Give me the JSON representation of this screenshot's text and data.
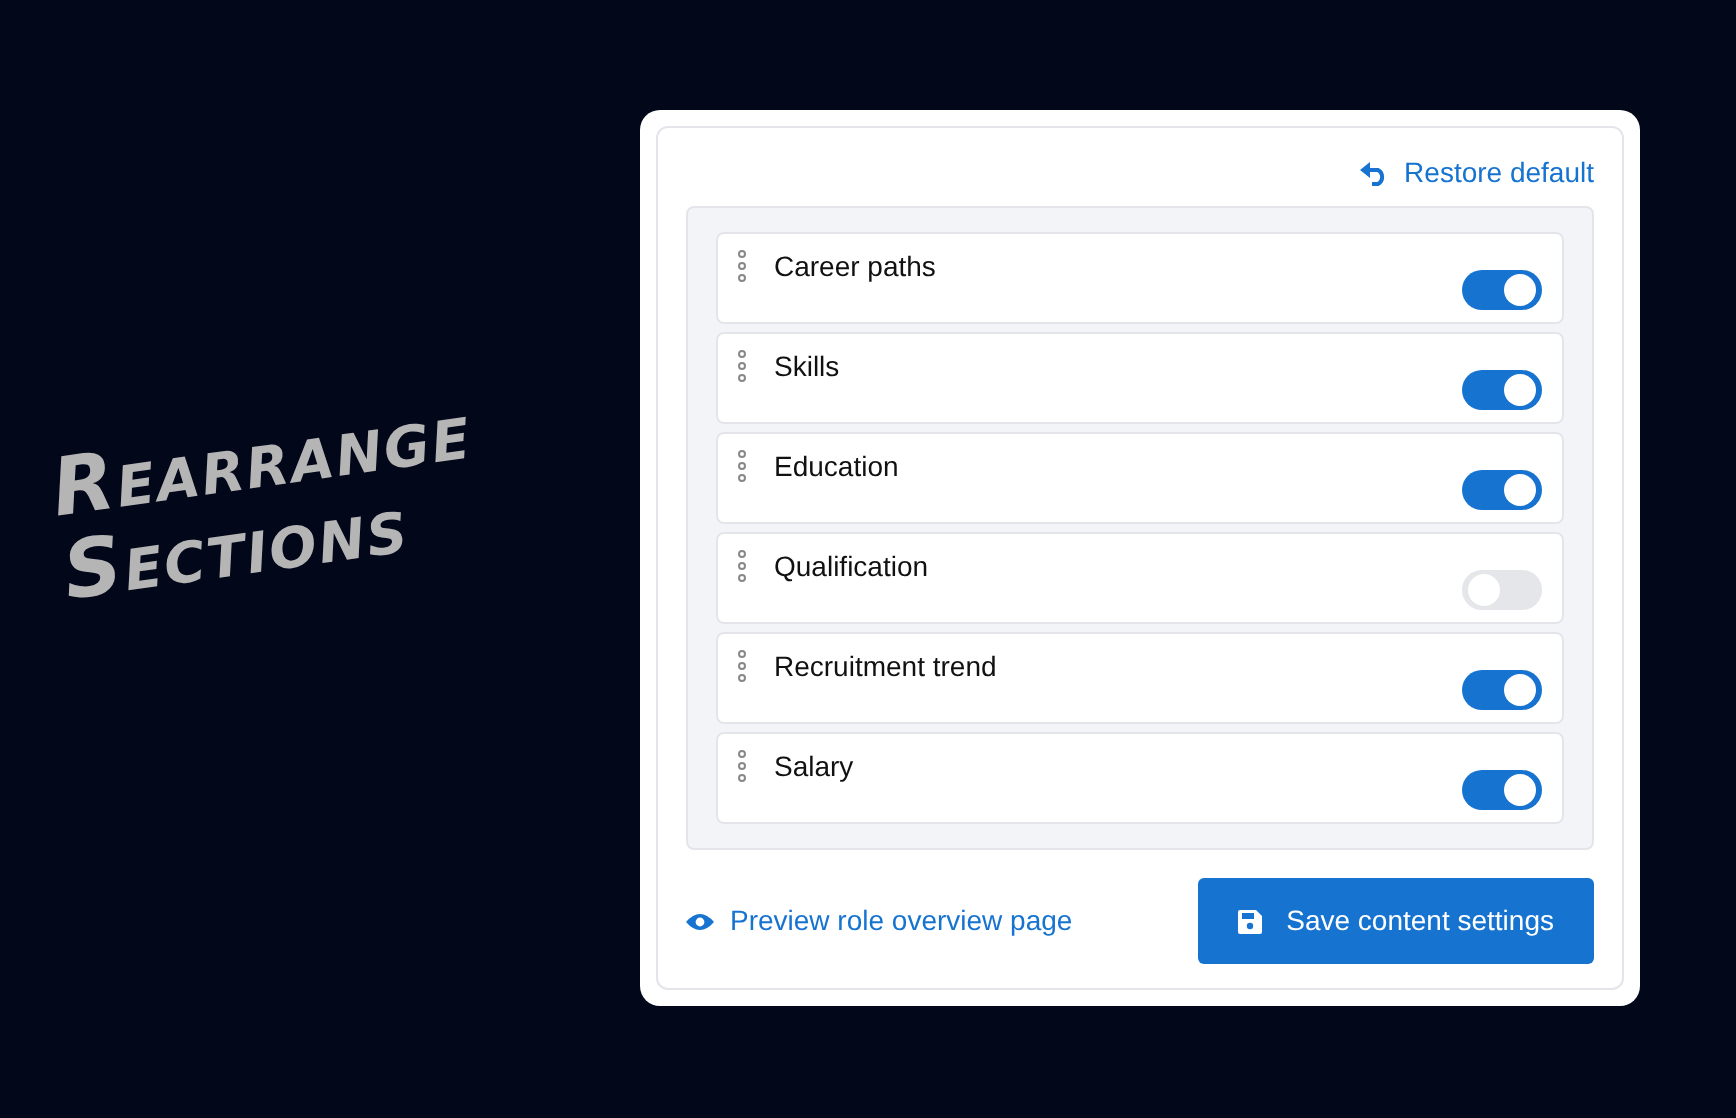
{
  "headline": "Rearrange Sections",
  "restore_link": "Restore default",
  "sections": [
    {
      "label": "Career paths",
      "on": true
    },
    {
      "label": "Skills",
      "on": true
    },
    {
      "label": "Education",
      "on": true
    },
    {
      "label": "Qualification",
      "on": false
    },
    {
      "label": "Recruitment trend",
      "on": true
    },
    {
      "label": "Salary",
      "on": true
    }
  ],
  "preview_link": "Preview role overview page",
  "save_button": "Save content settings"
}
